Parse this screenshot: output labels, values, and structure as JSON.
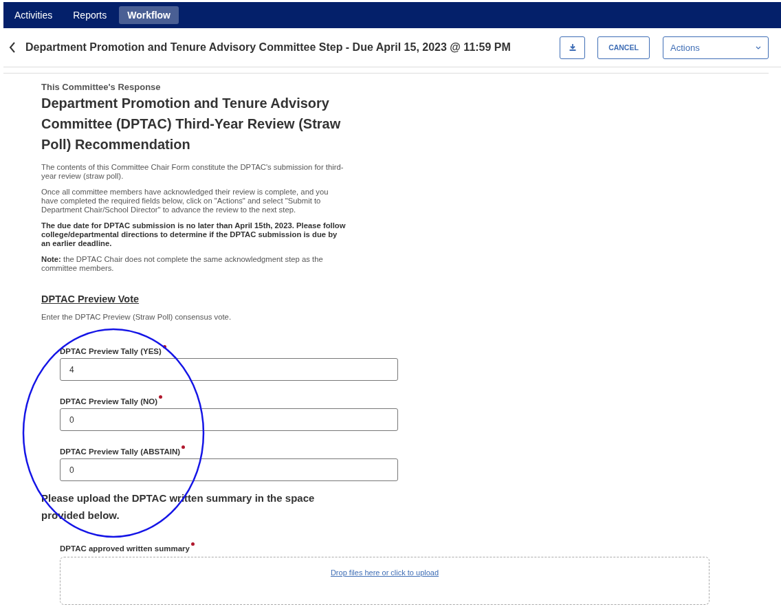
{
  "nav": {
    "tabs": [
      {
        "label": "Activities",
        "selected": false
      },
      {
        "label": "Reports",
        "selected": false
      },
      {
        "label": "Workflow",
        "selected": true
      }
    ]
  },
  "header": {
    "title": "Department Promotion and Tenure Advisory Committee Step - Due April 15, 2023 @ 11:59 PM",
    "cancel_button": "CANCEL",
    "actions_dropdown": "Actions"
  },
  "form": {
    "eyebrow": "This Committee's Response",
    "heading": "Department Promotion and Tenure Advisory Committee (DPTAC) Third-Year Review (Straw Poll) Recommendation",
    "paragraphs": [
      {
        "text": "The contents of this Committee Chair Form constitute the DPTAC's submission for third-year review (straw poll).",
        "bold": false
      },
      {
        "text": "Once all committee members have acknowledged their review is complete, and you have completed the required fields below, click on \"Actions\" and select \"Submit to Department Chair/School Director\" to advance the review to the next step.",
        "bold": false
      },
      {
        "text": "The due date for DPTAC submission is no later than April 15th, 2023.  Please follow college/departmental directions to determine if the DPTAC submission is due by an earlier deadline.",
        "bold": true
      },
      {
        "text": "**Note:** the DPTAC Chair does not complete the same acknowledgment step as the committee members.",
        "bold": false
      }
    ],
    "vote_section": {
      "heading": "DPTAC Preview Vote",
      "instructions": "Enter the DPTAC Preview (Straw Poll) consensus vote.",
      "fields": [
        {
          "label": "DPTAC Preview Tally (YES)",
          "required": true,
          "value": "4"
        },
        {
          "label": "DPTAC Preview Tally (NO)",
          "required": true,
          "value": "0"
        },
        {
          "label": "DPTAC Preview Tally (ABSTAIN)",
          "required": true,
          "value": "0"
        }
      ]
    },
    "upload_heading": "Please upload the DPTAC written summary in the space provided below.",
    "upload": {
      "label": "DPTAC approved written summary",
      "required": true,
      "drop_text": "Drop files here or click to upload"
    }
  }
}
